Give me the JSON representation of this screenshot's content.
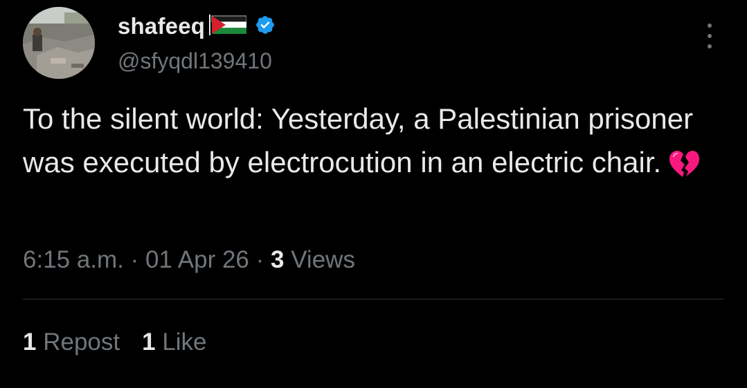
{
  "tweet": {
    "author": {
      "display_name": "shafeeq",
      "handle": "@sfyqdl139410",
      "verified": true,
      "flag_icon": "palestine-flag",
      "avatar_icon": "rubble-photo-avatar"
    },
    "text": "To the silent world: Yesterday, a Palestinian prisoner was executed by electrocution in an electric chair.",
    "emoji_icon": "broken-heart",
    "time": "6:15 a.m.",
    "date": "01 Apr 26",
    "views_count": "3",
    "views_label": "Views",
    "separator": "·",
    "reposts_count": "1",
    "reposts_label": "Repost",
    "likes_count": "1",
    "likes_label": "Like"
  },
  "colors": {
    "background": "#000000",
    "primary_text": "#e7e9ea",
    "secondary_text": "#71767b",
    "verified_badge": "#1d9bf0",
    "divider": "#2f3336",
    "broken_heart": "#f91880"
  }
}
